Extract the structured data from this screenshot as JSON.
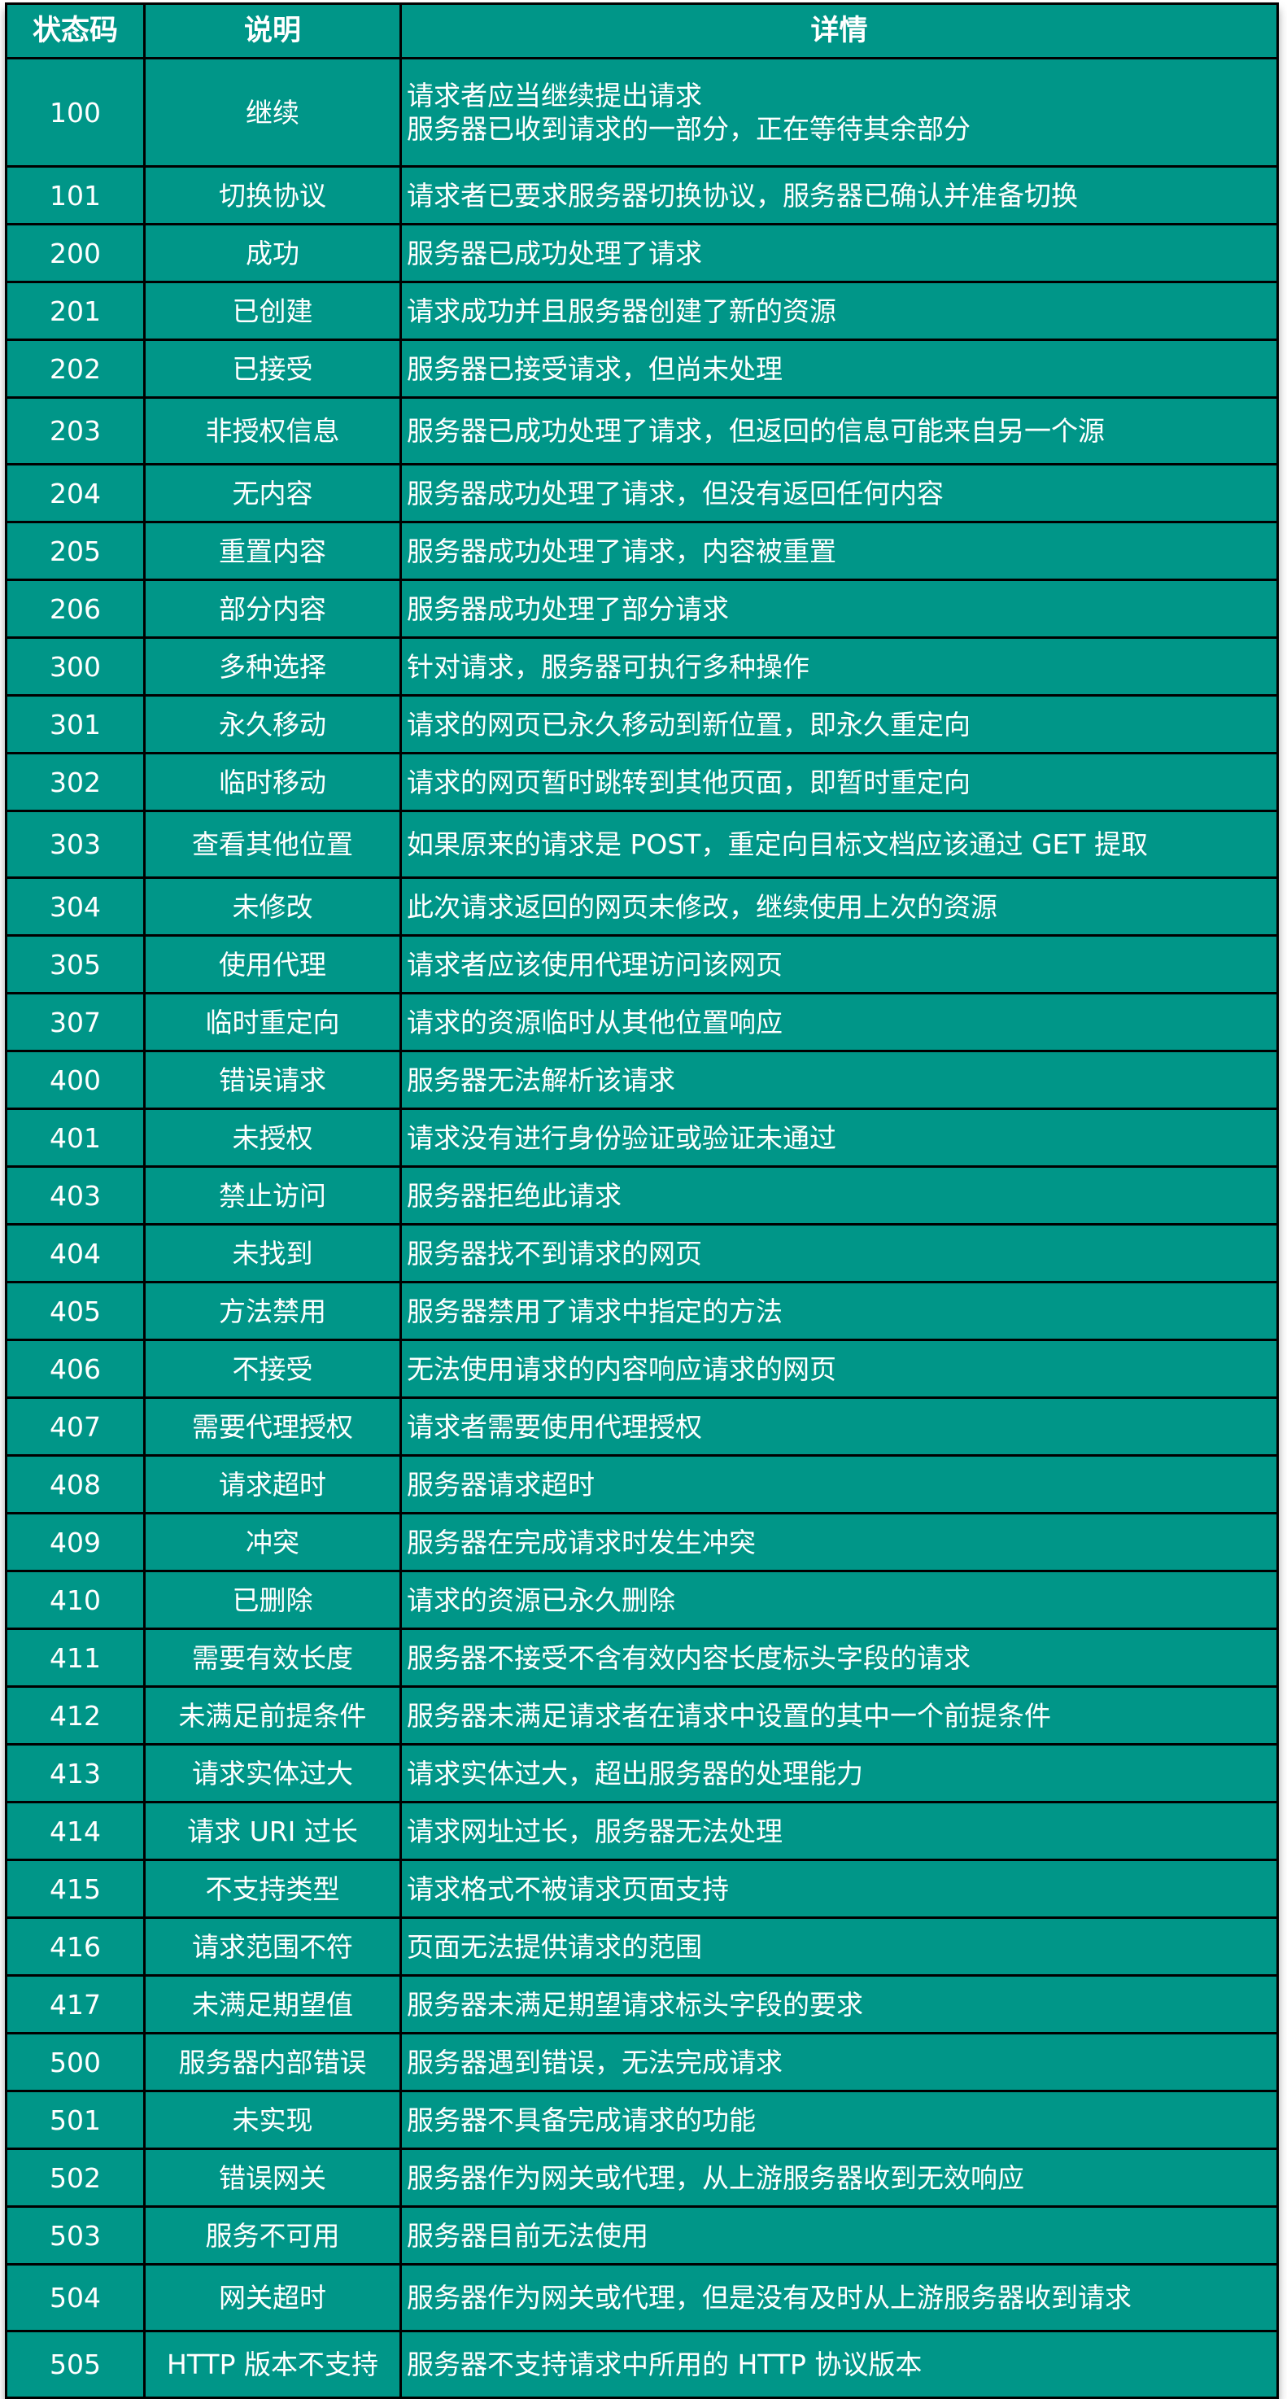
{
  "table": {
    "headers": [
      "状态码",
      "说明",
      "详情"
    ],
    "rows": [
      {
        "code": "100",
        "name": "继续",
        "detail": "请求者应当继续提出请求\n服务器已收到请求的一部分，正在等待其余部分"
      },
      {
        "code": "101",
        "name": "切换协议",
        "detail": "请求者已要求服务器切换协议，服务器已确认并准备切换"
      },
      {
        "code": "200",
        "name": "成功",
        "detail": "服务器已成功处理了请求"
      },
      {
        "code": "201",
        "name": "已创建",
        "detail": "请求成功并且服务器创建了新的资源"
      },
      {
        "code": "202",
        "name": "已接受",
        "detail": "服务器已接受请求，但尚未处理"
      },
      {
        "code": "203",
        "name": "非授权信息",
        "detail": "服务器已成功处理了请求，但返回的信息可能来自另一个源"
      },
      {
        "code": "204",
        "name": "无内容",
        "detail": "服务器成功处理了请求，但没有返回任何内容"
      },
      {
        "code": "205",
        "name": "重置内容",
        "detail": "服务器成功处理了请求，内容被重置"
      },
      {
        "code": "206",
        "name": "部分内容",
        "detail": "服务器成功处理了部分请求"
      },
      {
        "code": "300",
        "name": "多种选择",
        "detail": "针对请求，服务器可执行多种操作"
      },
      {
        "code": "301",
        "name": "永久移动",
        "detail": "请求的网页已永久移动到新位置，即永久重定向"
      },
      {
        "code": "302",
        "name": "临时移动",
        "detail": "请求的网页暂时跳转到其他页面，即暂时重定向"
      },
      {
        "code": "303",
        "name": "查看其他位置",
        "detail": "如果原来的请求是 POST，重定向目标文档应该通过 GET 提取"
      },
      {
        "code": "304",
        "name": "未修改",
        "detail": "此次请求返回的网页未修改，继续使用上次的资源"
      },
      {
        "code": "305",
        "name": "使用代理",
        "detail": "请求者应该使用代理访问该网页"
      },
      {
        "code": "307",
        "name": "临时重定向",
        "detail": "请求的资源临时从其他位置响应"
      },
      {
        "code": "400",
        "name": "错误请求",
        "detail": "服务器无法解析该请求"
      },
      {
        "code": "401",
        "name": "未授权",
        "detail": "请求没有进行身份验证或验证未通过"
      },
      {
        "code": "403",
        "name": "禁止访问",
        "detail": "服务器拒绝此请求"
      },
      {
        "code": "404",
        "name": "未找到",
        "detail": "服务器找不到请求的网页"
      },
      {
        "code": "405",
        "name": "方法禁用",
        "detail": "服务器禁用了请求中指定的方法"
      },
      {
        "code": "406",
        "name": "不接受",
        "detail": "无法使用请求的内容响应请求的网页"
      },
      {
        "code": "407",
        "name": "需要代理授权",
        "detail": "请求者需要使用代理授权"
      },
      {
        "code": "408",
        "name": "请求超时",
        "detail": "服务器请求超时"
      },
      {
        "code": "409",
        "name": "冲突",
        "detail": "服务器在完成请求时发生冲突"
      },
      {
        "code": "410",
        "name": "已删除",
        "detail": "请求的资源已永久删除"
      },
      {
        "code": "411",
        "name": "需要有效长度",
        "detail": "服务器不接受不含有效内容长度标头字段的请求"
      },
      {
        "code": "412",
        "name": "未满足前提条件",
        "detail": "服务器未满足请求者在请求中设置的其中一个前提条件"
      },
      {
        "code": "413",
        "name": "请求实体过大",
        "detail": "请求实体过大，超出服务器的处理能力"
      },
      {
        "code": "414",
        "name": "请求 URI 过长",
        "detail": "请求网址过长，服务器无法处理"
      },
      {
        "code": "415",
        "name": "不支持类型",
        "detail": "请求格式不被请求页面支持"
      },
      {
        "code": "416",
        "name": "请求范围不符",
        "detail": "页面无法提供请求的范围"
      },
      {
        "code": "417",
        "name": "未满足期望值",
        "detail": "服务器未满足期望请求标头字段的要求"
      },
      {
        "code": "500",
        "name": "服务器内部错误",
        "detail": "服务器遇到错误，无法完成请求"
      },
      {
        "code": "501",
        "name": "未实现",
        "detail": "服务器不具备完成请求的功能"
      },
      {
        "code": "502",
        "name": "错误网关",
        "detail": "服务器作为网关或代理，从上游服务器收到无效响应"
      },
      {
        "code": "503",
        "name": "服务不可用",
        "detail": "服务器目前无法使用"
      },
      {
        "code": "504",
        "name": "网关超时",
        "detail": "服务器作为网关或代理，但是没有及时从上游服务器收到请求"
      },
      {
        "code": "505",
        "name": "HTTP 版本不支持",
        "detail": "服务器不支持请求中所用的 HTTP 协议版本"
      }
    ]
  },
  "colors": {
    "background": "#009688",
    "text": "#ffffff",
    "border": "#000000"
  }
}
